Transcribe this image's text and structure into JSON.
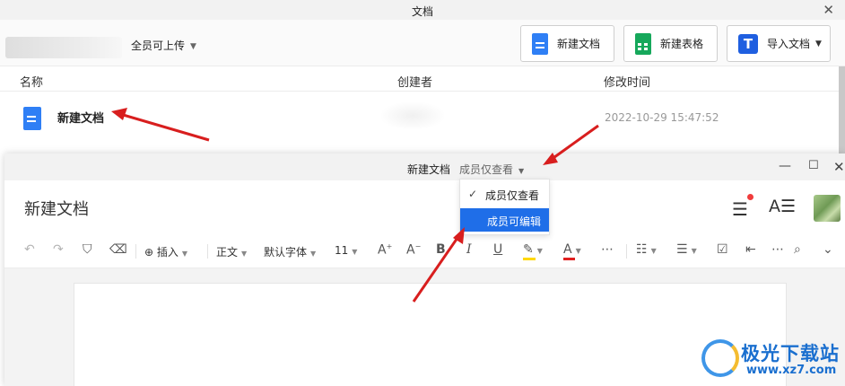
{
  "back_window": {
    "title": "文档",
    "upload_permission": "全员可上传",
    "buttons": {
      "new_doc": "新建文档",
      "new_sheet": "新建表格",
      "import": "导入文档"
    },
    "columns": {
      "name": "名称",
      "creator": "创建者",
      "modified": "修改时间"
    },
    "files": [
      {
        "name": "新建文档",
        "modified": "2022-10-29 15:47:52"
      }
    ]
  },
  "editor": {
    "title": "新建文档",
    "permission": "成员仅查看",
    "doc_title": "新建文档",
    "toolbar": {
      "insert": "插入",
      "paragraph": "正文",
      "font": "默认字体",
      "size": "11"
    }
  },
  "perm_menu": {
    "options": [
      "成员仅查看",
      "成员可编辑"
    ],
    "checked_index": 0,
    "highlighted_index": 1
  },
  "watermark": {
    "name": "极光下载站",
    "url": "www.xz7.com"
  },
  "colors": {
    "accent": "#1f6ee8",
    "arrow": "#d81e1e",
    "doc_blue": "#2f7ff5",
    "sheet_green": "#16a85b"
  }
}
